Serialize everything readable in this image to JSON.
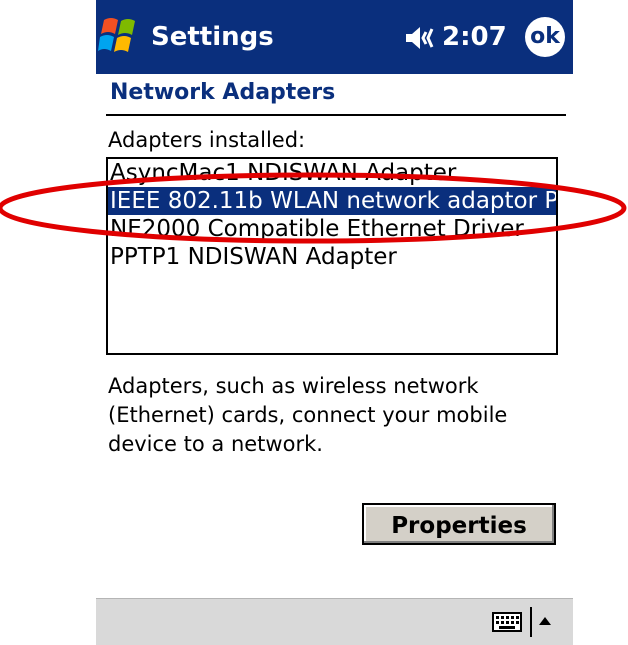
{
  "status_bar": {
    "app_title": "Settings",
    "time": "2:07",
    "ok_label": "ok"
  },
  "page": {
    "title": "Network Adapters",
    "installed_label": "Adapters installed:"
  },
  "adapters": [
    {
      "name": "AsyncMac1 NDISWAN Adapter",
      "selected": false
    },
    {
      "name": "IEEE 802.11b WLAN network adaptor P",
      "selected": true
    },
    {
      "name": "NE2000 Compatible Ethernet Driver",
      "selected": false
    },
    {
      "name": "PPTP1 NDISWAN Adapter",
      "selected": false
    }
  ],
  "description": "Adapters, such as wireless network (Ethernet) cards, connect your mobile device to a network.",
  "buttons": {
    "properties_label": "Properties"
  },
  "icons": {
    "start": "windows-flag-icon",
    "volume": "speaker-icon",
    "keyboard": "keyboard-icon",
    "sip_toggle": "up-arrow-icon"
  },
  "colors": {
    "titlebar": "#0a2f7d",
    "selection": "#0a2f7d",
    "highlight_ellipse": "#e00000"
  }
}
